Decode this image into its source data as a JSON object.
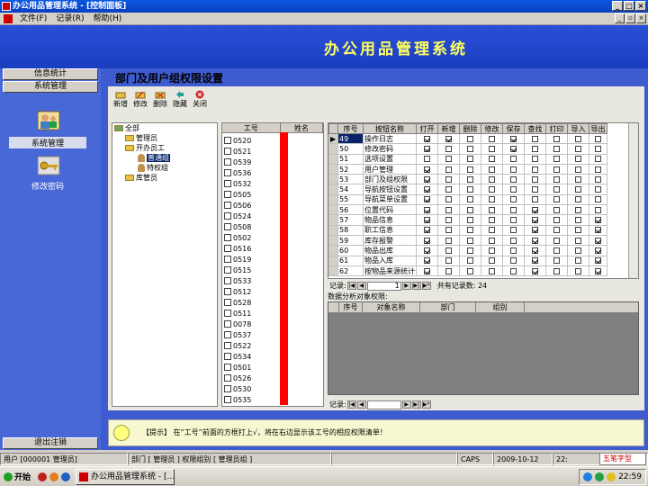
{
  "window": {
    "title": "办公用品管理系统 - [控制面板]"
  },
  "menu": [
    "文件(F)",
    "记录(R)",
    "帮助(H)"
  ],
  "banner": {
    "title": "办公用品管理系统"
  },
  "left": {
    "top_btn1": "信息统计",
    "top_btn2": "系统管理",
    "item1": "系统管理",
    "item2": "修改密码",
    "bottom_btn": "退出注销"
  },
  "page": {
    "title": "部门及用户组权限设置"
  },
  "toolbar": [
    "新增",
    "修改",
    "删除",
    "隐藏",
    "关闭"
  ],
  "tree": {
    "root": "全部",
    "n1": "管理员",
    "n2": "开办员工",
    "n3": "普通组",
    "n4": "特权组",
    "n5": "库管员"
  },
  "userlist": {
    "col1": "工号",
    "col2": "姓名",
    "rows": [
      "0520",
      "0521",
      "0539",
      "0536",
      "0532",
      "0505",
      "0506",
      "0524",
      "0508",
      "0502",
      "0516",
      "0519",
      "0515",
      "0533",
      "0512",
      "0528",
      "0511",
      "0078",
      "0537",
      "0522",
      "0534",
      "0501",
      "0526",
      "0530",
      "0535"
    ]
  },
  "grid": {
    "headers": [
      "序号",
      "按钮名称",
      "打开",
      "新增",
      "删除",
      "修改",
      "保存",
      "查找",
      "打印",
      "导入",
      "导出"
    ],
    "rows": [
      {
        "no": "49",
        "name": "操作日志",
        "c": [
          1,
          1,
          0,
          0,
          1,
          0,
          0,
          0,
          0
        ]
      },
      {
        "no": "50",
        "name": "修改密码",
        "c": [
          1,
          0,
          0,
          0,
          1,
          0,
          0,
          0,
          0
        ]
      },
      {
        "no": "51",
        "name": "选项设置",
        "c": [
          0,
          0,
          0,
          0,
          0,
          0,
          0,
          0,
          0
        ]
      },
      {
        "no": "52",
        "name": "用户管理",
        "c": [
          1,
          0,
          0,
          0,
          0,
          0,
          0,
          0,
          0
        ]
      },
      {
        "no": "53",
        "name": "部门及组权限",
        "c": [
          1,
          0,
          0,
          0,
          0,
          0,
          0,
          0,
          0
        ]
      },
      {
        "no": "54",
        "name": "导航按钮设置",
        "c": [
          1,
          0,
          0,
          0,
          0,
          0,
          0,
          0,
          0
        ]
      },
      {
        "no": "55",
        "name": "导航菜单设置",
        "c": [
          1,
          0,
          0,
          0,
          0,
          0,
          0,
          0,
          0
        ]
      },
      {
        "no": "56",
        "name": "位置代码",
        "c": [
          1,
          0,
          0,
          0,
          0,
          1,
          0,
          0,
          0
        ]
      },
      {
        "no": "57",
        "name": "物品信息",
        "c": [
          1,
          0,
          0,
          0,
          0,
          1,
          0,
          0,
          1
        ]
      },
      {
        "no": "58",
        "name": "职工信息",
        "c": [
          1,
          0,
          0,
          0,
          0,
          1,
          0,
          0,
          1
        ]
      },
      {
        "no": "59",
        "name": "库存报警",
        "c": [
          1,
          0,
          0,
          0,
          0,
          1,
          0,
          0,
          1
        ]
      },
      {
        "no": "60",
        "name": "物品出库",
        "c": [
          1,
          0,
          0,
          0,
          0,
          1,
          0,
          0,
          1
        ]
      },
      {
        "no": "61",
        "name": "物品入库",
        "c": [
          1,
          0,
          0,
          0,
          0,
          1,
          0,
          0,
          1
        ]
      },
      {
        "no": "62",
        "name": "按物品来源统计",
        "c": [
          1,
          0,
          0,
          0,
          0,
          1,
          0,
          0,
          1
        ]
      }
    ],
    "nav_label": "记录:",
    "nav_value": "1",
    "count_text": "共有记录数: 24"
  },
  "group": {
    "label": "数据分析对象权限:",
    "headers": [
      "序号",
      "对象名称",
      "部门",
      "组别"
    ],
    "nav_label": "记录:"
  },
  "tip": {
    "text": "【提示】 在“工号”前面的方框打上√，将在右边显示该工号的相应权限清单！"
  },
  "status": {
    "user": "用户 [000001 管理员]",
    "dept": "部门 [ 管理员 ]  权限组别 [ 管理员组 ]",
    "caps": "CAPS",
    "date": "2009-10-12",
    "time_short": "22:",
    "ime": "五笔字型"
  },
  "taskbar": {
    "start": "开始",
    "task": "办公用品管理系统 - [...",
    "clock": "22:59"
  }
}
